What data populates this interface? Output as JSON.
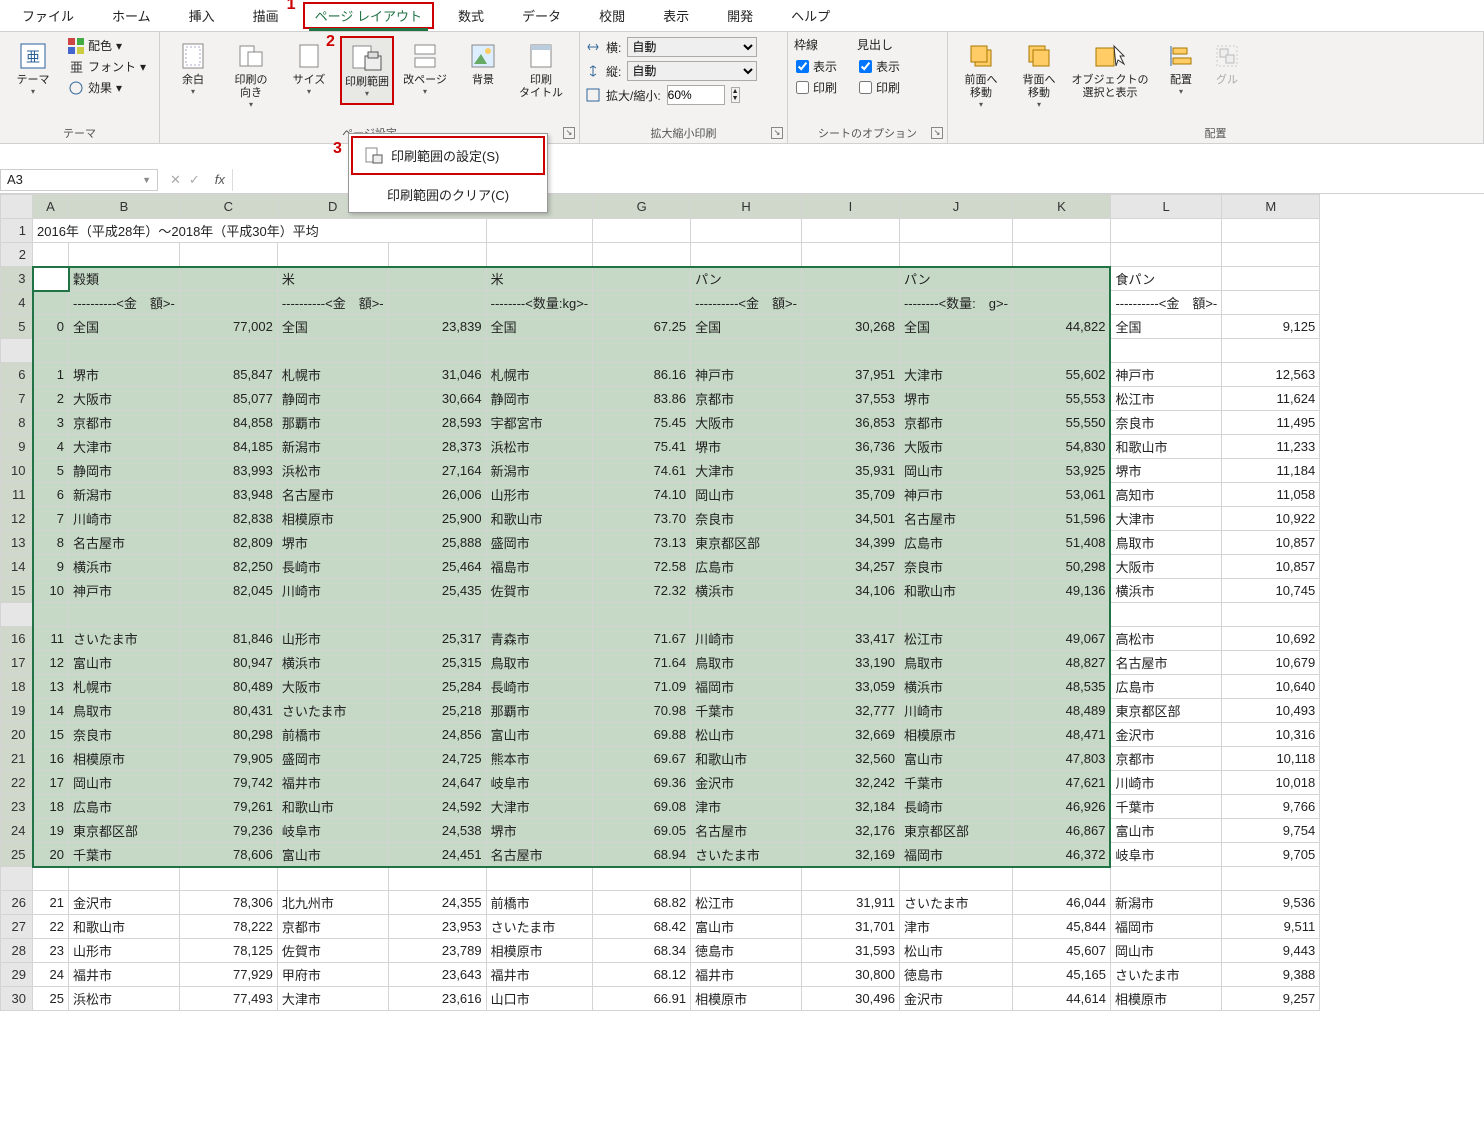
{
  "tabs": [
    "ファイル",
    "ホーム",
    "挿入",
    "描画",
    "ページ レイアウト",
    "数式",
    "データ",
    "校閲",
    "表示",
    "開発",
    "ヘルプ"
  ],
  "active_tab": 4,
  "markers": {
    "m1": "1",
    "m2": "2",
    "m3": "3"
  },
  "themes": {
    "theme": "テーマ",
    "haishoku": "配色",
    "font": "フォント",
    "kouka": "効果",
    "group": "テーマ"
  },
  "page_setup": {
    "yohaku": "余白",
    "muki": "印刷の\n向き",
    "size": "サイズ",
    "hanni": "印刷範囲",
    "kaipage": "改ページ",
    "haikei": "背景",
    "title": "印刷\nタイトル",
    "group": "ページ設定"
  },
  "dropdown": {
    "settei": "印刷範囲の設定(S)",
    "clear": "印刷範囲のクリア(C)"
  },
  "scale": {
    "yoko": "横:",
    "tate": "縦:",
    "auto": "自動",
    "kakudai": "拡大/縮小:",
    "pct": "60%",
    "group": "拡大縮小印刷"
  },
  "sheet_opts": {
    "wakusen": "枠線",
    "midashi": "見出し",
    "hyouji": "表示",
    "insatsu": "印刷",
    "group": "シートのオプション"
  },
  "arrange": {
    "zenmen": "前面へ\n移動",
    "haimen": "背面へ\n移動",
    "obj": "オブジェクトの\n選択と表示",
    "haichi": "配置",
    "group2": "グル",
    "group": "配置"
  },
  "name_box": "A3",
  "title_cell": "2016年（平成28年）〜2018年（平成30年）平均",
  "col_letters": [
    "A",
    "B",
    "C",
    "D",
    "E",
    "F",
    "G",
    "H",
    "I",
    "J",
    "K",
    "L",
    "M"
  ],
  "headers_r3": [
    "",
    "穀類",
    "",
    "米",
    "",
    "米",
    "",
    "パン",
    "",
    "パン",
    "",
    "食パン",
    ""
  ],
  "headers_r4": [
    "",
    "----------<金　額>-",
    "",
    "----------<金　額>-",
    "",
    "--------<数量:kg>-",
    "",
    "----------<金　額>-",
    "",
    "--------<数量:　g>-",
    "",
    "----------<金　額>-",
    ""
  ],
  "rows": [
    {
      "n": 5,
      "idx": "0",
      "cells": [
        "全国",
        "77,002",
        "全国",
        "23,839",
        "全国",
        "67.25",
        "全国",
        "30,268",
        "全国",
        "44,822",
        "全国",
        "9,125"
      ]
    },
    {
      "n": 6,
      "idx": "1",
      "cells": [
        "堺市",
        "85,847",
        "札幌市",
        "31,046",
        "札幌市",
        "86.16",
        "神戸市",
        "37,951",
        "大津市",
        "55,602",
        "神戸市",
        "12,563"
      ]
    },
    {
      "n": 7,
      "idx": "2",
      "cells": [
        "大阪市",
        "85,077",
        "静岡市",
        "30,664",
        "静岡市",
        "83.86",
        "京都市",
        "37,553",
        "堺市",
        "55,553",
        "松江市",
        "11,624"
      ]
    },
    {
      "n": 8,
      "idx": "3",
      "cells": [
        "京都市",
        "84,858",
        "那覇市",
        "28,593",
        "宇都宮市",
        "75.45",
        "大阪市",
        "36,853",
        "京都市",
        "55,550",
        "奈良市",
        "11,495"
      ]
    },
    {
      "n": 9,
      "idx": "4",
      "cells": [
        "大津市",
        "84,185",
        "新潟市",
        "28,373",
        "浜松市",
        "75.41",
        "堺市",
        "36,736",
        "大阪市",
        "54,830",
        "和歌山市",
        "11,233"
      ]
    },
    {
      "n": 10,
      "idx": "5",
      "cells": [
        "静岡市",
        "83,993",
        "浜松市",
        "27,164",
        "新潟市",
        "74.61",
        "大津市",
        "35,931",
        "岡山市",
        "53,925",
        "堺市",
        "11,184"
      ]
    },
    {
      "n": 11,
      "idx": "6",
      "cells": [
        "新潟市",
        "83,948",
        "名古屋市",
        "26,006",
        "山形市",
        "74.10",
        "岡山市",
        "35,709",
        "神戸市",
        "53,061",
        "高知市",
        "11,058"
      ]
    },
    {
      "n": 12,
      "idx": "7",
      "cells": [
        "川崎市",
        "82,838",
        "相模原市",
        "25,900",
        "和歌山市",
        "73.70",
        "奈良市",
        "34,501",
        "名古屋市",
        "51,596",
        "大津市",
        "10,922"
      ]
    },
    {
      "n": 13,
      "idx": "8",
      "cells": [
        "名古屋市",
        "82,809",
        "堺市",
        "25,888",
        "盛岡市",
        "73.13",
        "東京都区部",
        "34,399",
        "広島市",
        "51,408",
        "鳥取市",
        "10,857"
      ]
    },
    {
      "n": 14,
      "idx": "9",
      "cells": [
        "横浜市",
        "82,250",
        "長崎市",
        "25,464",
        "福島市",
        "72.58",
        "広島市",
        "34,257",
        "奈良市",
        "50,298",
        "大阪市",
        "10,857"
      ]
    },
    {
      "n": 15,
      "idx": "10",
      "cells": [
        "神戸市",
        "82,045",
        "川崎市",
        "25,435",
        "佐賀市",
        "72.32",
        "横浜市",
        "34,106",
        "和歌山市",
        "49,136",
        "横浜市",
        "10,745"
      ]
    },
    {
      "n": 16,
      "idx": "11",
      "cells": [
        "さいたま市",
        "81,846",
        "山形市",
        "25,317",
        "青森市",
        "71.67",
        "川崎市",
        "33,417",
        "松江市",
        "49,067",
        "高松市",
        "10,692"
      ]
    },
    {
      "n": 17,
      "idx": "12",
      "cells": [
        "富山市",
        "80,947",
        "横浜市",
        "25,315",
        "鳥取市",
        "71.64",
        "鳥取市",
        "33,190",
        "鳥取市",
        "48,827",
        "名古屋市",
        "10,679"
      ]
    },
    {
      "n": 18,
      "idx": "13",
      "cells": [
        "札幌市",
        "80,489",
        "大阪市",
        "25,284",
        "長崎市",
        "71.09",
        "福岡市",
        "33,059",
        "横浜市",
        "48,535",
        "広島市",
        "10,640"
      ]
    },
    {
      "n": 19,
      "idx": "14",
      "cells": [
        "鳥取市",
        "80,431",
        "さいたま市",
        "25,218",
        "那覇市",
        "70.98",
        "千葉市",
        "32,777",
        "川崎市",
        "48,489",
        "東京都区部",
        "10,493"
      ]
    },
    {
      "n": 20,
      "idx": "15",
      "cells": [
        "奈良市",
        "80,298",
        "前橋市",
        "24,856",
        "富山市",
        "69.88",
        "松山市",
        "32,669",
        "相模原市",
        "48,471",
        "金沢市",
        "10,316"
      ]
    },
    {
      "n": 21,
      "idx": "16",
      "cells": [
        "相模原市",
        "79,905",
        "盛岡市",
        "24,725",
        "熊本市",
        "69.67",
        "和歌山市",
        "32,560",
        "富山市",
        "47,803",
        "京都市",
        "10,118"
      ]
    },
    {
      "n": 22,
      "idx": "17",
      "cells": [
        "岡山市",
        "79,742",
        "福井市",
        "24,647",
        "岐阜市",
        "69.36",
        "金沢市",
        "32,242",
        "千葉市",
        "47,621",
        "川崎市",
        "10,018"
      ]
    },
    {
      "n": 23,
      "idx": "18",
      "cells": [
        "広島市",
        "79,261",
        "和歌山市",
        "24,592",
        "大津市",
        "69.08",
        "津市",
        "32,184",
        "長崎市",
        "46,926",
        "千葉市",
        "9,766"
      ]
    },
    {
      "n": 24,
      "idx": "19",
      "cells": [
        "東京都区部",
        "79,236",
        "岐阜市",
        "24,538",
        "堺市",
        "69.05",
        "名古屋市",
        "32,176",
        "東京都区部",
        "46,867",
        "富山市",
        "9,754"
      ]
    },
    {
      "n": 25,
      "idx": "20",
      "cells": [
        "千葉市",
        "78,606",
        "富山市",
        "24,451",
        "名古屋市",
        "68.94",
        "さいたま市",
        "32,169",
        "福岡市",
        "46,372",
        "岐阜市",
        "9,705"
      ]
    },
    {
      "n": 26,
      "idx": "21",
      "cells": [
        "金沢市",
        "78,306",
        "北九州市",
        "24,355",
        "前橋市",
        "68.82",
        "松江市",
        "31,911",
        "さいたま市",
        "46,044",
        "新潟市",
        "9,536"
      ]
    },
    {
      "n": 27,
      "idx": "22",
      "cells": [
        "和歌山市",
        "78,222",
        "京都市",
        "23,953",
        "さいたま市",
        "68.42",
        "富山市",
        "31,701",
        "津市",
        "45,844",
        "福岡市",
        "9,511"
      ]
    },
    {
      "n": 28,
      "idx": "23",
      "cells": [
        "山形市",
        "78,125",
        "佐賀市",
        "23,789",
        "相模原市",
        "68.34",
        "徳島市",
        "31,593",
        "松山市",
        "45,607",
        "岡山市",
        "9,443"
      ]
    },
    {
      "n": 29,
      "idx": "24",
      "cells": [
        "福井市",
        "77,929",
        "甲府市",
        "23,643",
        "福井市",
        "68.12",
        "福井市",
        "30,800",
        "徳島市",
        "45,165",
        "さいたま市",
        "9,388"
      ]
    },
    {
      "n": 30,
      "idx": "25",
      "cells": [
        "浜松市",
        "77,493",
        "大津市",
        "23,616",
        "山口市",
        "66.91",
        "相模原市",
        "30,496",
        "金沢市",
        "44,614",
        "相模原市",
        "9,257"
      ]
    }
  ]
}
